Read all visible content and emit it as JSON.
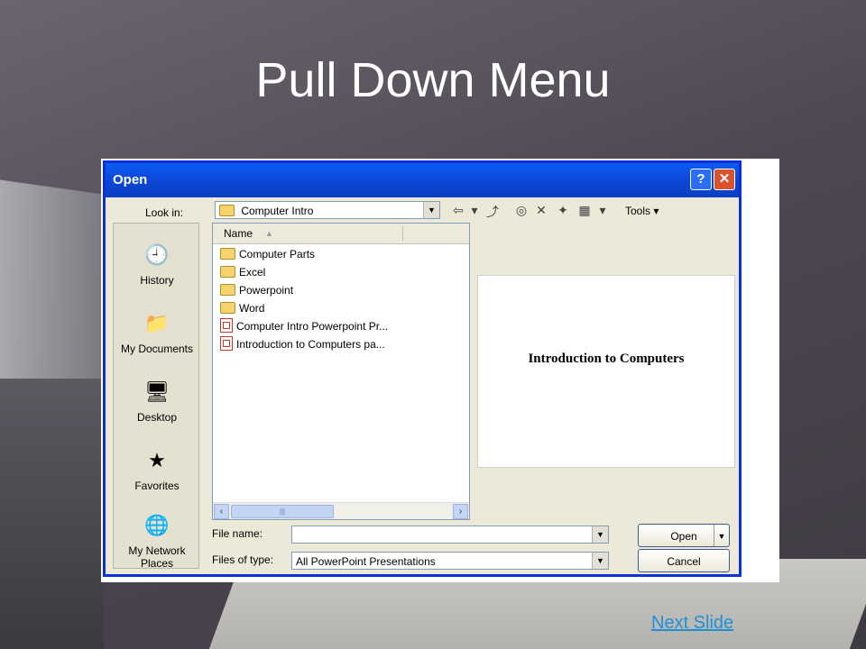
{
  "slide": {
    "title": "Pull Down Menu",
    "next_link": "Next Slide"
  },
  "dialog": {
    "title": "Open",
    "help_btn": "?",
    "close_btn": "✕",
    "look_in_label": "Look in:",
    "look_in_value": "Computer Intro",
    "toolbar": {
      "tools_label": "Tools ▾"
    },
    "places": [
      {
        "label": "History",
        "icon": "history-icon"
      },
      {
        "label": "My Documents",
        "icon": "my-documents-icon"
      },
      {
        "label": "Desktop",
        "icon": "desktop-icon"
      },
      {
        "label": "Favorites",
        "icon": "favorites-icon"
      },
      {
        "label": "My Network Places",
        "icon": "network-places-icon"
      }
    ],
    "column_name": "Name",
    "files": [
      {
        "name": "Computer Parts",
        "type": "folder"
      },
      {
        "name": "Excel",
        "type": "folder"
      },
      {
        "name": "Powerpoint",
        "type": "folder"
      },
      {
        "name": "Word",
        "type": "folder"
      },
      {
        "name": "Computer Intro Powerpoint Pr...",
        "type": "ppt"
      },
      {
        "name": "Introduction to Computers pa...",
        "type": "ppt"
      }
    ],
    "preview_text": "Introduction to Computers",
    "file_name_label": "File name:",
    "file_name_value": "",
    "files_of_type_label": "Files of type:",
    "files_of_type_value": "All PowerPoint Presentations",
    "open_btn": "Open",
    "cancel_btn": "Cancel"
  }
}
